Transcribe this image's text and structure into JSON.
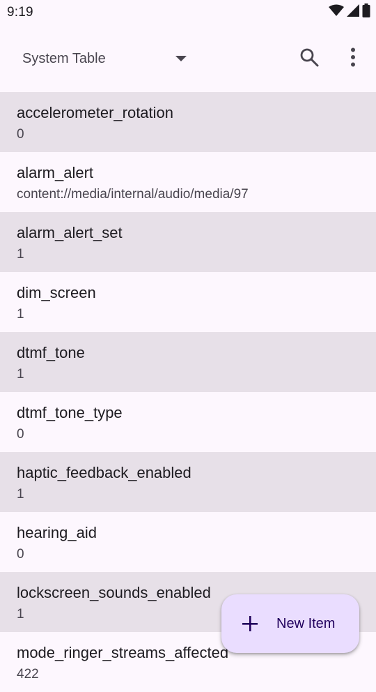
{
  "status_bar": {
    "time": "9:19",
    "icons": [
      "wifi-icon",
      "cell-signal-icon",
      "battery-icon"
    ]
  },
  "toolbar": {
    "table_selector": "System Table",
    "search_icon": "search-icon",
    "overflow_icon": "more-vert-icon"
  },
  "list": [
    {
      "key": "accelerometer_rotation",
      "value": "0"
    },
    {
      "key": "alarm_alert",
      "value": "content://media/internal/audio/media/97"
    },
    {
      "key": "alarm_alert_set",
      "value": "1"
    },
    {
      "key": "dim_screen",
      "value": "1"
    },
    {
      "key": "dtmf_tone",
      "value": "1"
    },
    {
      "key": "dtmf_tone_type",
      "value": "0"
    },
    {
      "key": "haptic_feedback_enabled",
      "value": "1"
    },
    {
      "key": "hearing_aid",
      "value": "0"
    },
    {
      "key": "lockscreen_sounds_enabled",
      "value": "1"
    },
    {
      "key": "mode_ringer_streams_affected",
      "value": "422"
    }
  ],
  "fab": {
    "label": "New Item",
    "icon": "plus-icon"
  },
  "colors": {
    "background": "#fdf7fe",
    "row_shaded": "#e7e0e8",
    "fab": "#eaddff",
    "fab_text": "#21005d"
  }
}
